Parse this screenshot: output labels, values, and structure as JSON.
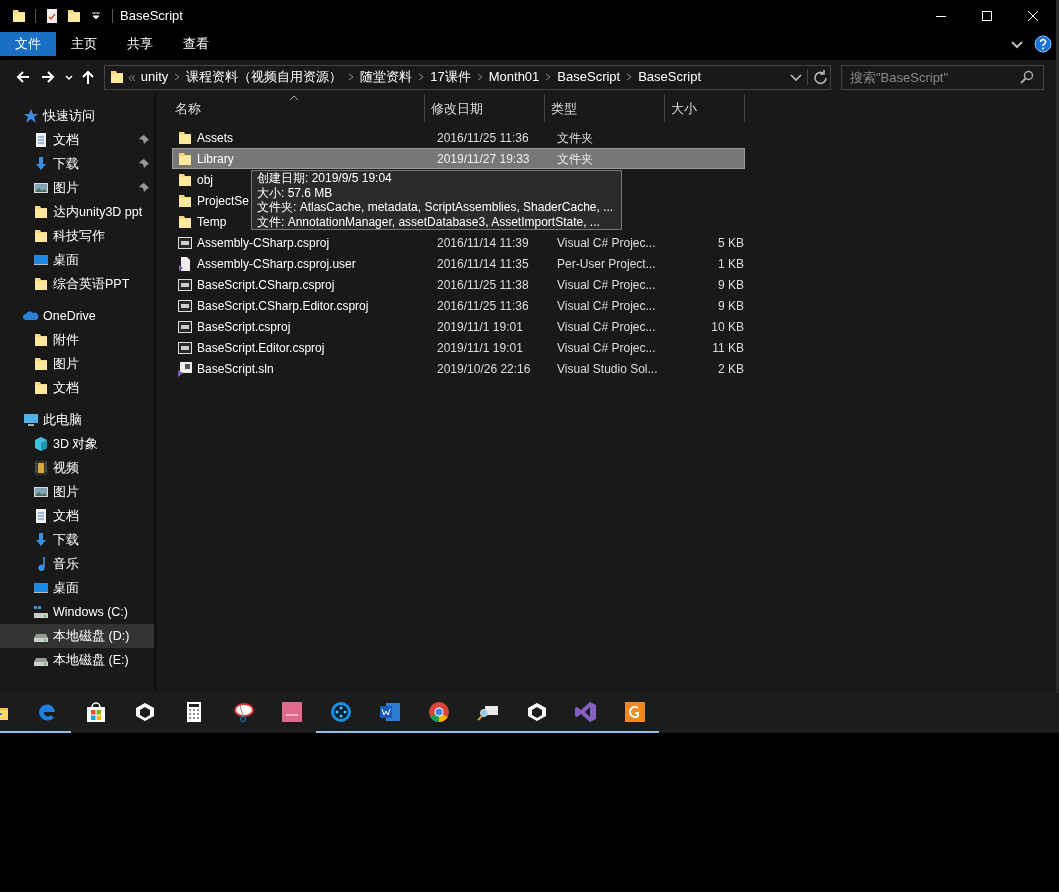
{
  "window": {
    "title": "BaseScript"
  },
  "quick_access_toolbar": [
    {
      "kind": "folder"
    },
    {
      "kind": "properties"
    },
    {
      "kind": "new-folder"
    },
    {
      "kind": "dropdown"
    }
  ],
  "ribbon_tabs": [
    {
      "label": "文件",
      "selected": true
    },
    {
      "label": "主页",
      "selected": false
    },
    {
      "label": "共享",
      "selected": false
    },
    {
      "label": "查看",
      "selected": false
    }
  ],
  "address": {
    "overflow": "«",
    "crumbs": [
      "unity",
      "课程资料（视频自用资源）",
      "随堂资料",
      "17课件",
      "Month01",
      "BaseScript",
      "BaseScript"
    ]
  },
  "search": {
    "placeholder": "搜索\"BaseScript\""
  },
  "sidebar": [
    {
      "label": "快速访问",
      "kind": "star",
      "selected": false,
      "children": [
        {
          "label": "文档",
          "kind": "doc",
          "pinned": true,
          "selected": false
        },
        {
          "label": "下载",
          "kind": "download",
          "pinned": true,
          "selected": false
        },
        {
          "label": "图片",
          "kind": "picture",
          "pinned": true,
          "selected": false
        },
        {
          "label": "达内unity3D ppt",
          "kind": "folder",
          "pinned": false,
          "selected": false
        },
        {
          "label": "科技写作",
          "kind": "folder",
          "pinned": false,
          "selected": false
        },
        {
          "label": "桌面",
          "kind": "desktop",
          "pinned": false,
          "selected": false
        },
        {
          "label": "综合英语PPT",
          "kind": "folder",
          "pinned": false,
          "selected": false
        }
      ]
    },
    {
      "label": "OneDrive",
      "kind": "cloud",
      "selected": false,
      "children": [
        {
          "label": "附件",
          "kind": "folder",
          "pinned": false,
          "selected": false
        },
        {
          "label": "图片",
          "kind": "folder",
          "pinned": false,
          "selected": false
        },
        {
          "label": "文档",
          "kind": "folder",
          "pinned": false,
          "selected": false
        }
      ]
    },
    {
      "label": "此电脑",
      "kind": "pc",
      "selected": false,
      "children": [
        {
          "label": "3D 对象",
          "kind": "cube",
          "pinned": false,
          "selected": false
        },
        {
          "label": "视频",
          "kind": "video",
          "pinned": false,
          "selected": false
        },
        {
          "label": "图片",
          "kind": "picture",
          "pinned": false,
          "selected": false
        },
        {
          "label": "文档",
          "kind": "doc",
          "pinned": false,
          "selected": false
        },
        {
          "label": "下载",
          "kind": "download",
          "pinned": false,
          "selected": false
        },
        {
          "label": "音乐",
          "kind": "music",
          "pinned": false,
          "selected": false
        },
        {
          "label": "桌面",
          "kind": "desktop",
          "pinned": false,
          "selected": false
        },
        {
          "label": "Windows (C:)",
          "kind": "drive-win",
          "pinned": false,
          "selected": false
        },
        {
          "label": "本地磁盘 (D:)",
          "kind": "drive",
          "pinned": false,
          "selected": true
        },
        {
          "label": "本地磁盘 (E:)",
          "kind": "drive",
          "pinned": false,
          "selected": false
        }
      ]
    }
  ],
  "columns": [
    {
      "label": "名称",
      "sorted": true
    },
    {
      "label": "修改日期",
      "sorted": false
    },
    {
      "label": "类型",
      "sorted": false
    },
    {
      "label": "大小",
      "sorted": false
    }
  ],
  "rows": [
    {
      "name": "Assets",
      "date": "2016/11/25 11:36",
      "type": "文件夹",
      "kind": "folder",
      "selected": false
    },
    {
      "name": "Library",
      "date": "2019/11/27 19:33",
      "type": "文件夹",
      "kind": "folder",
      "selected": true
    },
    {
      "name": "obj",
      "kind": "folder",
      "selected": false
    },
    {
      "name": "ProjectSe",
      "kind": "folder",
      "selected": false
    },
    {
      "name": "Temp",
      "kind": "folder",
      "selected": false
    },
    {
      "name": "Assembly-CSharp.csproj",
      "date": "2016/11/14 11:39",
      "type": "Visual C# Projec...",
      "size": "5 KB",
      "kind": "csproj",
      "selected": false
    },
    {
      "name": "Assembly-CSharp.csproj.user",
      "date": "2016/11/14 11:35",
      "type": "Per-User Project...",
      "size": "1 KB",
      "kind": "user",
      "selected": false
    },
    {
      "name": "BaseScript.CSharp.csproj",
      "date": "2016/11/25 11:38",
      "type": "Visual C# Projec...",
      "size": "9 KB",
      "kind": "csproj",
      "selected": false
    },
    {
      "name": "BaseScript.CSharp.Editor.csproj",
      "date": "2016/11/25 11:36",
      "type": "Visual C# Projec...",
      "size": "9 KB",
      "kind": "csproj",
      "selected": false
    },
    {
      "name": "BaseScript.csproj",
      "date": "2019/11/1 19:01",
      "type": "Visual C# Projec...",
      "size": "10 KB",
      "kind": "csproj",
      "selected": false
    },
    {
      "name": "BaseScript.Editor.csproj",
      "date": "2019/11/1 19:01",
      "type": "Visual C# Projec...",
      "size": "11 KB",
      "kind": "csproj",
      "selected": false
    },
    {
      "name": "BaseScript.sln",
      "date": "2019/10/26 22:16",
      "type": "Visual Studio Sol...",
      "size": "2 KB",
      "kind": "sln",
      "selected": false
    }
  ],
  "tooltip": {
    "lines": [
      "创建日期: 2019/9/5 19:04",
      "大小: 57.6 MB",
      "文件夹: AtlasCache, metadata, ScriptAssemblies, ShaderCache, ...",
      "文件: AnnotationManager, assetDatabase3, AssetImportState, ..."
    ]
  },
  "taskbar": [
    {
      "kind": "explorer",
      "running": true
    },
    {
      "kind": "edge",
      "running": true
    },
    {
      "kind": "store",
      "running": false
    },
    {
      "kind": "unity",
      "running": false
    },
    {
      "kind": "calculator",
      "running": false
    },
    {
      "kind": "snipping",
      "running": false
    },
    {
      "kind": "pink-app",
      "running": false
    },
    {
      "kind": "film-app",
      "running": true
    },
    {
      "kind": "word",
      "running": true
    },
    {
      "kind": "chrome",
      "running": true
    },
    {
      "kind": "magnifier",
      "running": true
    },
    {
      "kind": "unity",
      "running": true
    },
    {
      "kind": "vs",
      "running": true
    },
    {
      "kind": "pdf",
      "running": true
    }
  ]
}
